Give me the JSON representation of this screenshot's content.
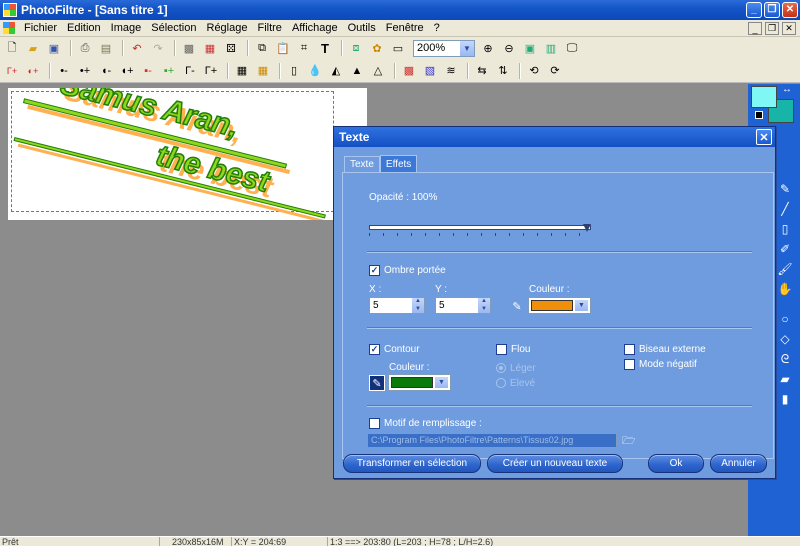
{
  "window": {
    "title": "PhotoFiltre - [Sans titre 1]"
  },
  "menu": [
    "Fichier",
    "Edition",
    "Image",
    "Sélection",
    "Réglage",
    "Filtre",
    "Affichage",
    "Outils",
    "Fenêtre",
    "?"
  ],
  "toolbar": {
    "zoom_value": "200%"
  },
  "canvas_text": {
    "line1": "Samus Aran,",
    "line2": "the best",
    "fill_color": "#8fd61c",
    "contour_color": "#1f7f08",
    "shadow_color": "#ffb050"
  },
  "dialog": {
    "title": "Texte",
    "tabs": [
      "Texte",
      "Effets"
    ],
    "opacity": {
      "label": "Opacité : 100%",
      "value": 100
    },
    "shadow": {
      "label": "Ombre portée",
      "checked": true,
      "x_label": "X :",
      "x_value": "5",
      "y_label": "Y :",
      "y_value": "5",
      "color_label": "Couleur :",
      "color": "#f0900a"
    },
    "contour": {
      "label": "Contour",
      "checked": true,
      "color_label": "Couleur :",
      "color": "#0a7a0a"
    },
    "flou": {
      "label": "Flou",
      "checked": false,
      "opt_light": "Léger",
      "opt_strong": "Elevé"
    },
    "biseau": {
      "label": "Biseau externe",
      "checked": false
    },
    "negatif": {
      "label": "Mode négatif",
      "checked": false
    },
    "motif": {
      "label": "Motif de remplissage :",
      "checked": false,
      "path": "C:\\Program Files\\PhotoFiltre\\Patterns\\Tissus02.jpg"
    },
    "buttons": {
      "transform": "Transformer en sélection",
      "create": "Créer un nouveau texte",
      "ok": "Ok",
      "cancel": "Annuler"
    }
  },
  "status": {
    "ready": "Prêt",
    "size": "230x85x16M",
    "cursor": "X:Y = 204:69",
    "info": "1:3 ==> 203:80 (L=203 ; H=78 ; L/H=2.6)"
  }
}
